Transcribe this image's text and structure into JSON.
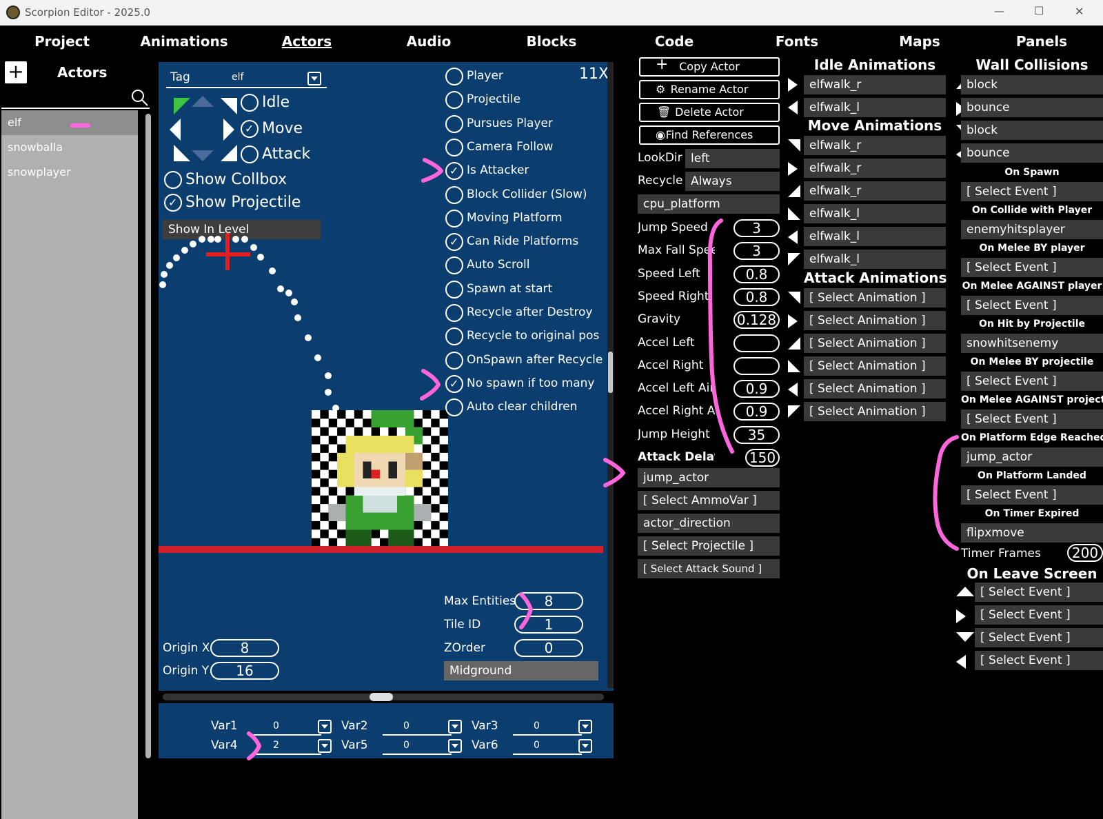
{
  "window": {
    "title": "Scorpion Editor - 2025.0",
    "minimize": "—",
    "maximize": "☐",
    "close": "✕"
  },
  "menu": [
    "Project",
    "Animations",
    "Actors",
    "Audio",
    "Blocks",
    "Code",
    "Fonts",
    "Maps",
    "Panels"
  ],
  "sidebar": {
    "add_glyph": "+",
    "title": "Actors",
    "actors": [
      "elf",
      "snowballa",
      "snowplayer"
    ]
  },
  "canvas": {
    "tag_label": "Tag",
    "tag_value": "elf",
    "zoom": "11X",
    "states": [
      "Idle",
      "Move",
      "Attack"
    ],
    "show_collbox": "Show Collbox",
    "show_projectile": "Show Projectile",
    "show_in_level": "Show In Level",
    "flags": [
      "Player",
      "Projectile",
      "Pursues Player",
      "Camera Follow",
      "Is Attacker",
      "Block Collider (Slow)",
      "Moving Platform",
      "Can Ride Platforms",
      "Auto Scroll",
      "Spawn at start",
      "Recycle after Destroy",
      "Recycle to original pos",
      "OnSpawn after Recycle",
      "No spawn if too many",
      "Auto clear children"
    ],
    "flags_checked": [
      false,
      false,
      false,
      false,
      true,
      false,
      false,
      true,
      false,
      false,
      false,
      false,
      false,
      true,
      false
    ],
    "max_entities_label": "Max Entities",
    "max_entities": "8",
    "tile_id_label": "Tile ID",
    "tile_id": "1",
    "zorder_label": "ZOrder",
    "zorder": "0",
    "layer": "Midground",
    "origin_x_label": "Origin X",
    "origin_x": "8",
    "origin_y_label": "Origin Y",
    "origin_y": "16"
  },
  "vars": [
    {
      "label": "Var1",
      "value": "0"
    },
    {
      "label": "Var2",
      "value": "0"
    },
    {
      "label": "Var3",
      "value": "0"
    },
    {
      "label": "Var4",
      "value": "2"
    },
    {
      "label": "Var5",
      "value": "0"
    },
    {
      "label": "Var6",
      "value": "0"
    }
  ],
  "actions": {
    "copy": "Copy Actor",
    "rename": "Rename Actor",
    "delete": "Delete Actor",
    "find": "Find References"
  },
  "props": {
    "lookdir_label": "LookDir",
    "lookdir": "left",
    "recycle_label": "Recycle",
    "recycle": "Always",
    "behaviour": "cpu_platform",
    "numbers": [
      {
        "label": "Jump Speed",
        "value": "3"
      },
      {
        "label": "Max Fall Speed",
        "value": "3"
      },
      {
        "label": "Speed Left",
        "value": "0.8"
      },
      {
        "label": "Speed Right",
        "value": "0.8"
      },
      {
        "label": "Gravity",
        "value": "0.128"
      },
      {
        "label": "Accel Left",
        "value": ""
      },
      {
        "label": "Accel Right",
        "value": ""
      },
      {
        "label": "Accel Left Air",
        "value": "0.9"
      },
      {
        "label": "Accel Right Air",
        "value": "0.9"
      },
      {
        "label": "Jump Height",
        "value": "35"
      },
      {
        "label": "Attack Delay",
        "value": "150"
      }
    ],
    "attack_event": "jump_actor",
    "ammo": "[ Select AmmoVar ]",
    "direction": "actor_direction",
    "projectile": "[ Select Projectile ]",
    "attack_sound": "[ Select Attack Sound ]"
  },
  "animations": {
    "idle_title": "Idle Animations",
    "idle": [
      "elfwalk_r",
      "elfwalk_l"
    ],
    "move_title": "Move Animations",
    "move": [
      "elfwalk_r",
      "elfwalk_r",
      "elfwalk_r",
      "elfwalk_l",
      "elfwalk_l",
      "elfwalk_l"
    ],
    "attack_title": "Attack Animations",
    "attack": [
      "[ Select Animation ]",
      "[ Select Animation ]",
      "[ Select Animation ]",
      "[ Select Animation ]",
      "[ Select Animation ]",
      "[ Select Animation ]"
    ]
  },
  "collisions": {
    "title": "Wall Collisions",
    "walls": [
      "block",
      "bounce",
      "block",
      "bounce"
    ],
    "events": [
      {
        "label": "On Spawn",
        "value": "[ Select Event ]"
      },
      {
        "label": "On Collide with Player",
        "value": "enemyhitsplayer"
      },
      {
        "label": "On Melee BY player",
        "value": "[ Select Event ]"
      },
      {
        "label": "On Melee AGAINST player",
        "value": "[ Select Event ]"
      },
      {
        "label": "On Hit by Projectile",
        "value": "snowhitsenemy"
      },
      {
        "label": "On Melee BY projectile",
        "value": "[ Select Event ]"
      },
      {
        "label": "On Melee AGAINST projectile",
        "value": "[ Select Event ]"
      },
      {
        "label": "On Platform Edge Reached",
        "value": "jump_actor"
      },
      {
        "label": "On Platform Landed",
        "value": "[ Select Event ]"
      },
      {
        "label": "On Timer Expired",
        "value": "flipxmove"
      }
    ],
    "timer_label": "Timer Frames",
    "timer_value": "200",
    "leave_title": "On Leave Screen",
    "leave": [
      "[ Select Event ]",
      "[ Select Event ]",
      "[ Select Event ]",
      "[ Select Event ]"
    ]
  }
}
